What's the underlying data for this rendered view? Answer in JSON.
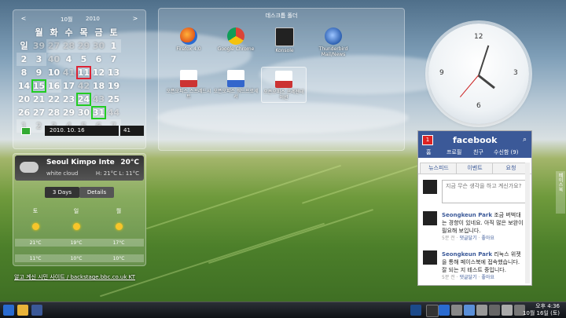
{
  "calendar": {
    "month": "10월",
    "year": "2010",
    "prev": "<",
    "next": ">",
    "weekdays": [
      "월",
      "화",
      "수",
      "목",
      "금",
      "토",
      "일"
    ],
    "rows": [
      {
        "week": "39",
        "days": [
          "27",
          "28",
          "29",
          "30",
          "1",
          "2",
          "3"
        ]
      },
      {
        "week": "40",
        "days": [
          "4",
          "5",
          "6",
          "7",
          "8",
          "9",
          "10"
        ]
      },
      {
        "week": "41",
        "days": [
          "11",
          "12",
          "13",
          "14",
          "15",
          "16",
          "17"
        ]
      },
      {
        "week": "42",
        "days": [
          "18",
          "19",
          "20",
          "21",
          "22",
          "23",
          "24"
        ]
      },
      {
        "week": "43",
        "days": [
          "25",
          "26",
          "27",
          "28",
          "29",
          "30",
          "31"
        ]
      },
      {
        "week": "44",
        "days": [
          "1",
          "2",
          "3",
          "4",
          "5",
          "6",
          "7"
        ]
      }
    ],
    "date_value": "2010. 10. 16",
    "week_value": "41"
  },
  "weather": {
    "city": "Seoul Kimpo Inte",
    "temp": "20°C",
    "desc": "white cloud",
    "hilo": "H: 21°C L: 11°C",
    "tab_3days": "3 Days",
    "tab_details": "Details",
    "days": [
      {
        "name": "토",
        "high": "21°C",
        "low": "11°C"
      },
      {
        "name": "일",
        "high": "19°C",
        "low": "10°C"
      },
      {
        "name": "월",
        "high": "17°C",
        "low": "10°C"
      }
    ],
    "link": "알고 계신 시민 사이트 / backstage.bbc.co.uk KT"
  },
  "folder": {
    "title": "데스크톱 폴더",
    "icons": [
      {
        "label": "Firefox 4.0",
        "color": "#2a6bd0"
      },
      {
        "label": "Google Chrome",
        "color": "#dc3b2a"
      },
      {
        "label": "Konsole",
        "color": "#222"
      },
      {
        "label": "Thunderbird Mail/News",
        "color": "#2c5fb0"
      },
      {
        "label": "오픈오피스 스프레드시트",
        "color": "#e9e9e9"
      },
      {
        "label": "오픈오피스 워드프로세서",
        "color": "#e9e9e9"
      },
      {
        "label": "오픈오피스 프레젠테이션",
        "color": "#e9e9e9"
      }
    ]
  },
  "clock": {
    "n12": "12",
    "n3": "3",
    "n6": "6",
    "n9": "9"
  },
  "facebook": {
    "badge": "1",
    "logo": "facebook",
    "nav": [
      "홈",
      "프로필",
      "친구",
      "수신함 (9)"
    ],
    "tabs": [
      "뉴스피드",
      "이벤트",
      "요청"
    ],
    "status_placeholder": "지금 무슨 생각을 하고 계신가요?",
    "posts": [
      {
        "name": "Seongkeun Park",
        "text": "조금 버벅대는 경향이 있네요. 아직 많은 보완이 필요해 보입니다.",
        "meta_time": "5분 전 · ",
        "meta_comment": "댓글달기",
        "meta_like": "좋아요"
      },
      {
        "name": "Seongkeun Park",
        "text": "리눅스 위젯을 통해 페이스북에 접속했습니다. 잘 되는 지 테스트 중입니다.",
        "meta_time": "5분 전 · ",
        "meta_comment": "댓글달기",
        "meta_like": "좋아요"
      }
    ]
  },
  "sidetab": "페이스북",
  "taskbar": {
    "time": "오후 4:36",
    "date": "10월 16일 (토)"
  }
}
